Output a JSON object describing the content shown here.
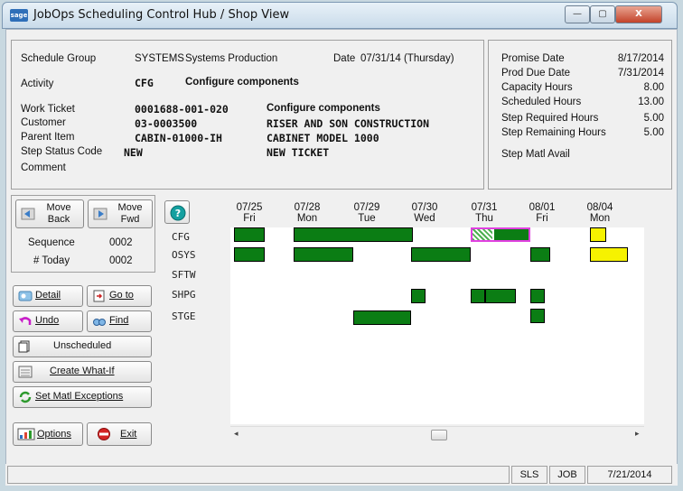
{
  "window": {
    "title": "JobOps Scheduling Control Hub / Shop View",
    "icon_label": "sage",
    "minimize": "—",
    "maximize": "▢",
    "close": "X"
  },
  "header": {
    "schedule_group_label": "Schedule Group",
    "schedule_group_code": "SYSTEMS",
    "schedule_group_name": "Systems Production",
    "date_label": "Date",
    "date_value": "07/31/14 (Thursday)",
    "activity_label": "Activity",
    "activity_code": "CFG",
    "activity_name": "Configure components",
    "work_ticket_label": "Work Ticket",
    "work_ticket_value": "0001688-001-020",
    "work_ticket_desc": "Configure components",
    "customer_label": "Customer",
    "customer_value": "03-0003500",
    "customer_name": "RISER AND SON CONSTRUCTION",
    "parent_item_label": "Parent Item",
    "parent_item_value": "CABIN-01000-IH",
    "parent_item_desc": "CABINET MODEL 1000",
    "step_status_label": "Step  Status Code",
    "step_status_value": "NEW",
    "step_status_desc": "NEW TICKET",
    "comment_label": "Comment"
  },
  "summary": {
    "promise_date_label": "Promise Date",
    "promise_date_value": "8/17/2014",
    "prod_due_label": "Prod Due Date",
    "prod_due_value": "7/31/2014",
    "capacity_label": "Capacity Hours",
    "capacity_value": "8.00",
    "scheduled_label": "Scheduled Hours",
    "scheduled_value": "13.00",
    "required_label": "Step Required Hours",
    "required_value": "5.00",
    "remaining_label": "Step Remaining Hours",
    "remaining_value": "5.00",
    "matl_label": "Step Matl Avail"
  },
  "nav": {
    "move_back": "Move Back",
    "move_fwd": "Move Fwd",
    "sequence_label": "Sequence",
    "sequence_value": "0002",
    "today_label": "# Today",
    "today_value": "0002",
    "detail": "Detail",
    "goto": "Go to",
    "undo": "Undo",
    "find": "Find",
    "unscheduled": "Unscheduled",
    "create_whatif": "Create What-If",
    "set_matl": "Set Matl Exceptions",
    "options": "Options",
    "exit": "Exit"
  },
  "gantt": {
    "rows": [
      "CFG",
      "OSYS",
      "SFTW",
      "SHPG",
      "STGE"
    ],
    "dates": [
      {
        "date": "07/25",
        "day": "Fri"
      },
      {
        "date": "07/28",
        "day": "Mon"
      },
      {
        "date": "07/29",
        "day": "Tue"
      },
      {
        "date": "07/30",
        "day": "Wed"
      },
      {
        "date": "07/31",
        "day": "Thu"
      },
      {
        "date": "08/01",
        "day": "Fri"
      },
      {
        "date": "08/04",
        "day": "Mon"
      }
    ],
    "bar_color": "#0b7d14",
    "future_color": "#f6f200",
    "selected_color": "#e040e0"
  },
  "statusbar": {
    "module": "SLS",
    "type": "JOB",
    "date": "7/21/2014"
  }
}
